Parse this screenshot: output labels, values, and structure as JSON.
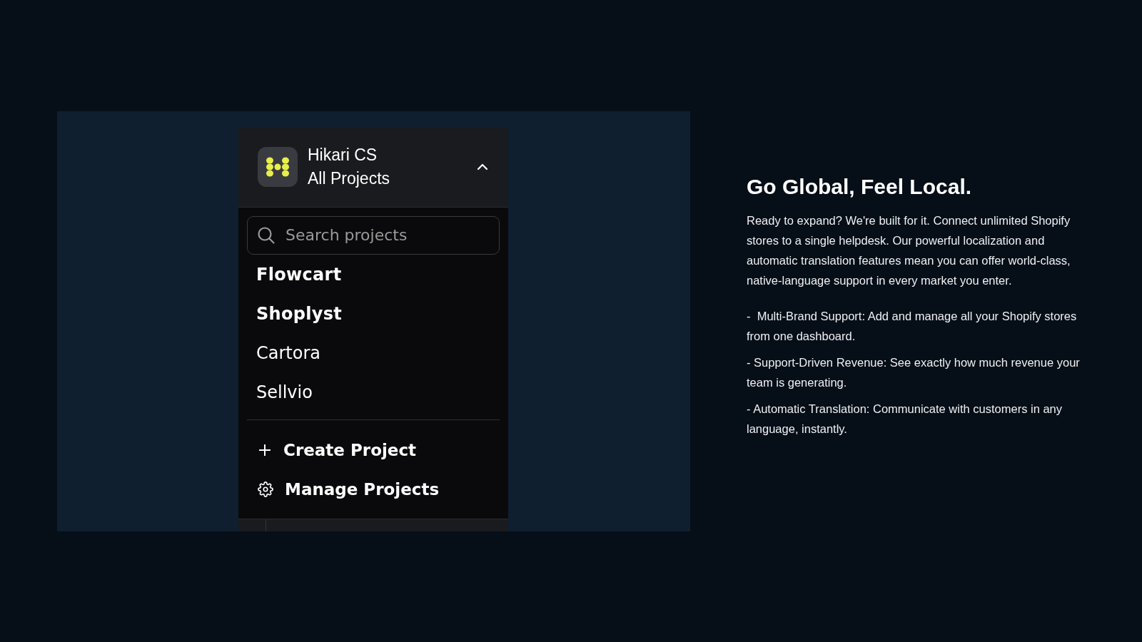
{
  "switcher": {
    "workspace": "Hikari CS",
    "scope": "All Projects",
    "expanded": true,
    "search": {
      "placeholder": "Search projects"
    },
    "projects": [
      {
        "name": "Flowcart",
        "selected": true
      },
      {
        "name": "Shoplyst",
        "selected": true
      },
      {
        "name": "Cartora",
        "selected": false
      },
      {
        "name": "Sellvio",
        "selected": false
      }
    ],
    "actions": [
      {
        "kind": "create",
        "label": "Create Project"
      },
      {
        "kind": "manage",
        "label": "Manage Projects"
      }
    ]
  },
  "copy": {
    "heading": "Go Global, Feel Local.",
    "intro": "Ready to expand? We're built for it. Connect unlimited Shopify stores to a single helpdesk. Our powerful localization and automatic translation features mean you can offer world-class, native-language support in every market you enter.",
    "features": [
      "-  Multi-Brand Support: Add and manage all your Shopify stores from one dashboard.",
      "- Support-Driven Revenue: See exactly how much revenue your team is generating.",
      "- Automatic Translation: Communicate with customers in any language, instantly."
    ]
  }
}
